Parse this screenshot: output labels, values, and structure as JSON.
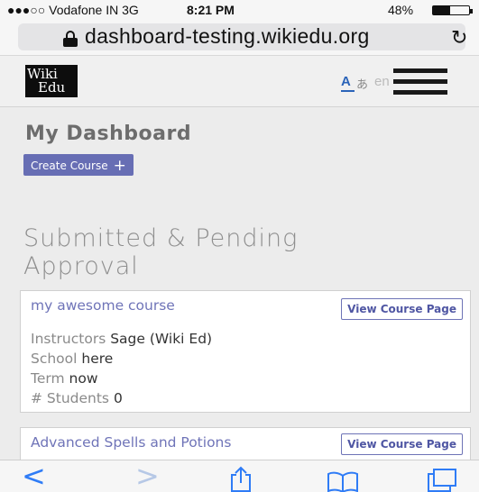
{
  "status_bar": {
    "carrier": "●●●○○ Vodafone IN  3G",
    "time": "8:21 PM",
    "battery_text": "48%",
    "battery_level": 0.48
  },
  "browser": {
    "url": "dashboard-testing.wikiedu.org",
    "icons": [
      "lock-icon",
      "reload-icon"
    ]
  },
  "header": {
    "logo_line1": "Wiki",
    "logo_line2": "Edu",
    "language_glyph_a": "A",
    "language_glyph_jp": "あ",
    "language_code": "en",
    "icons": [
      "translate-icon",
      "hamburger-menu-icon"
    ]
  },
  "main": {
    "title": "My Dashboard",
    "create_button": "Create Course",
    "create_button_icon": "+",
    "section_title": "Submitted & Pending Approval",
    "courses": [
      {
        "title": "my awesome course",
        "view_button": "View Course Page",
        "instructors_label": "Instructors",
        "instructors_value": "Sage (Wiki Ed)",
        "school_label": "School",
        "school_value": "here",
        "term_label": "Term",
        "term_value": "now",
        "students_label": "# Students",
        "students_value": "0"
      },
      {
        "title": "Advanced Spells and Potions",
        "view_button": "View Course Page"
      }
    ]
  },
  "toolbar": {
    "back_glyph": "<",
    "forward_glyph": ">",
    "icons": [
      "back-icon",
      "forward-icon",
      "share-icon",
      "bookmarks-icon",
      "tabs-icon"
    ],
    "colors": {
      "active": "#2f7cf6",
      "disabled": "#b6c8e6"
    }
  },
  "colors": {
    "brand_purple": "#676eb4",
    "link_purple": "#6f74b8"
  }
}
